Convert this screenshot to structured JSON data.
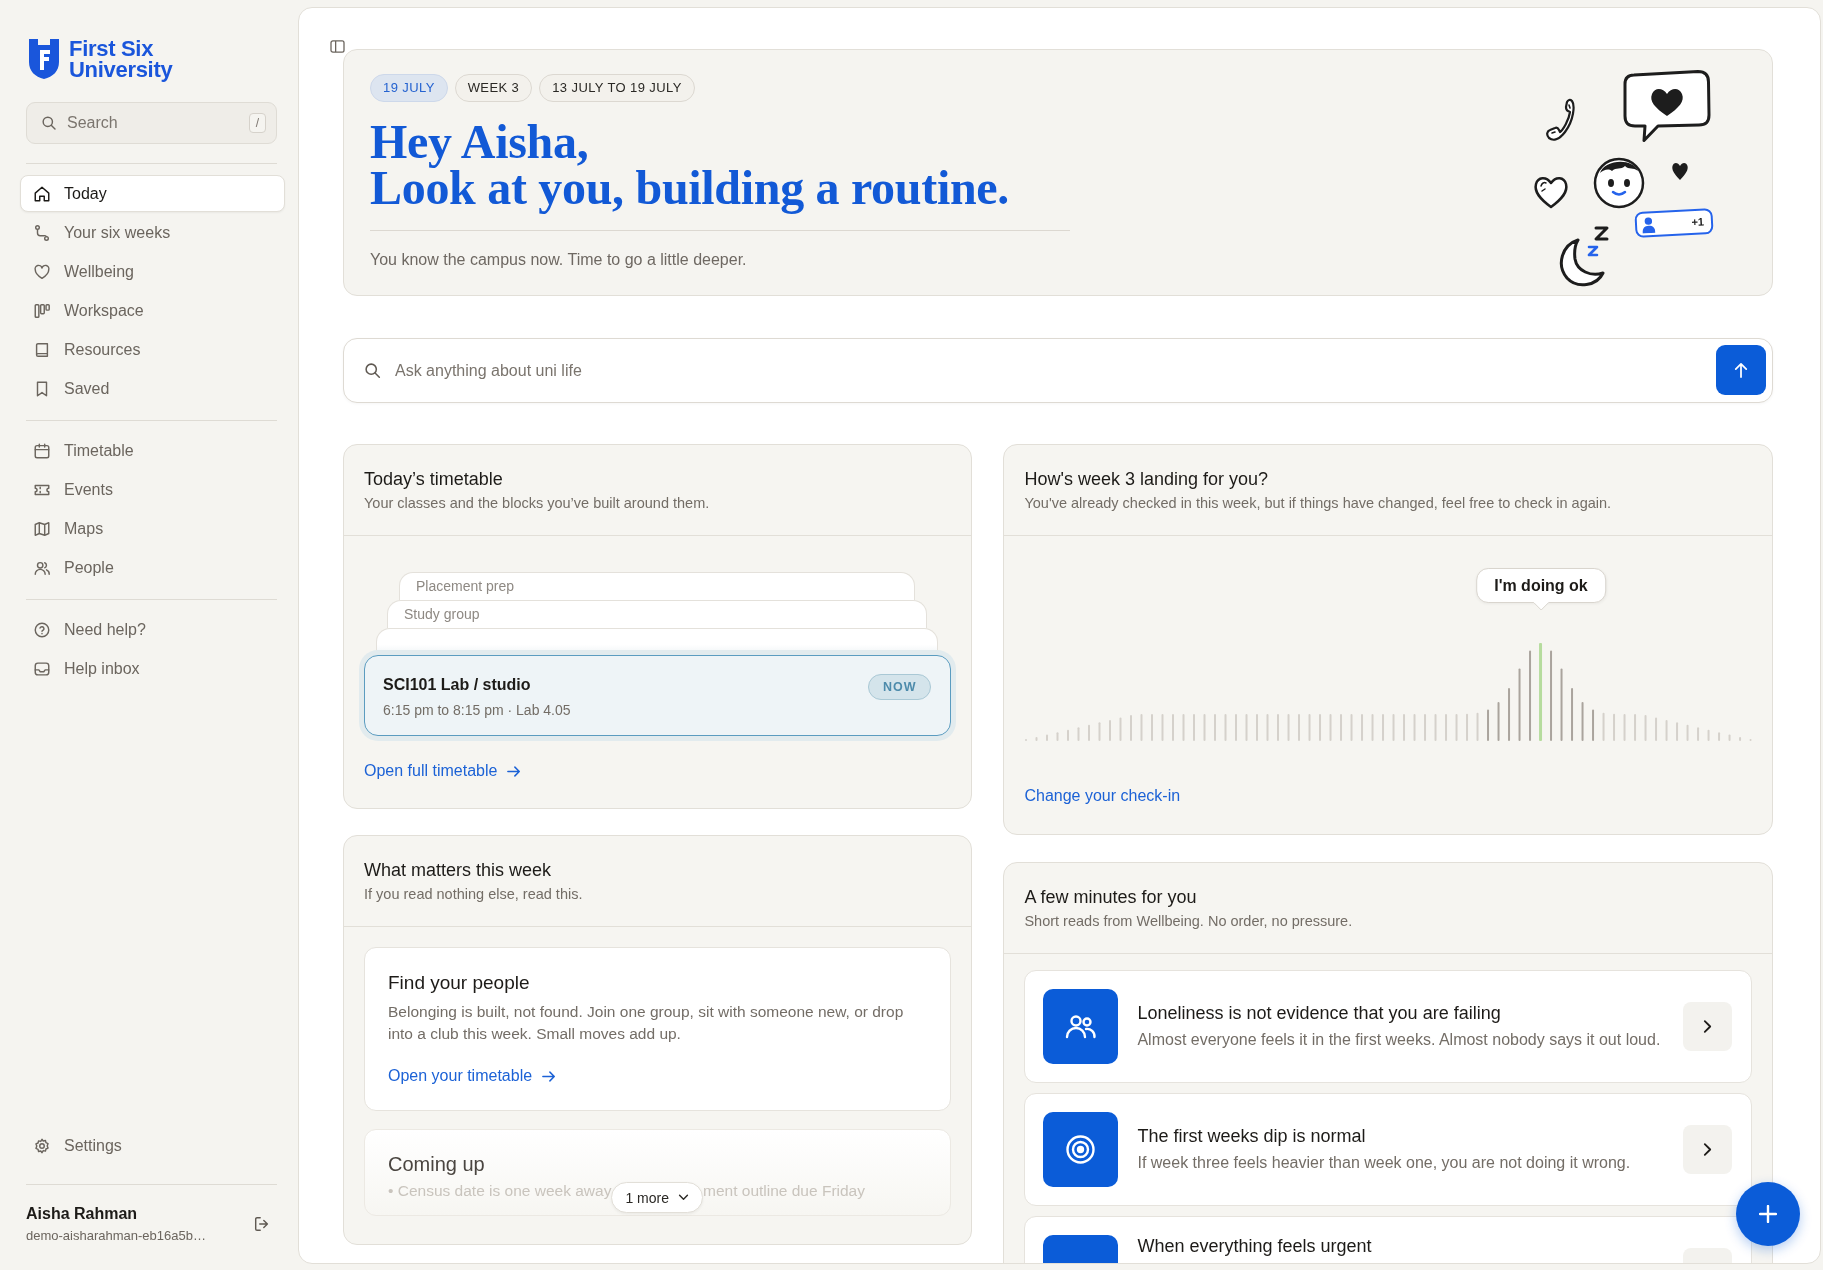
{
  "sidebar": {
    "brand": "First Six University",
    "search": {
      "placeholder": "Search",
      "shortcut": "/"
    },
    "nav_sections": [
      {
        "items": [
          {
            "label": "Today",
            "selected": true
          },
          {
            "label": "Your six weeks",
            "selected": false
          },
          {
            "label": "Wellbeing",
            "selected": false
          },
          {
            "label": "Workspace",
            "selected": false
          },
          {
            "label": "Resources",
            "selected": false
          },
          {
            "label": "Saved",
            "selected": false
          }
        ]
      },
      {
        "items": [
          {
            "label": "Timetable",
            "selected": false
          },
          {
            "label": "Events",
            "selected": false
          },
          {
            "label": "Maps",
            "selected": false
          },
          {
            "label": "People",
            "selected": false
          }
        ]
      },
      {
        "items": [
          {
            "label": "Need help?",
            "selected": false
          },
          {
            "label": "Help inbox",
            "selected": false
          }
        ]
      }
    ],
    "settings": {
      "label": "Settings",
      "selected": false
    },
    "user": {
      "name": "Aisha Rahman",
      "email": "demo-aisharahman-eb16a5b…"
    }
  },
  "hero": {
    "chips": [
      {
        "label": "19 JULY",
        "highlighted": true
      },
      {
        "label": "WEEK 3",
        "highlighted": false
      },
      {
        "label": "13 JULY TO 19 JULY",
        "highlighted": false
      }
    ],
    "greeting": "Hey Aisha,",
    "headline": "Look at you, building a routine.",
    "subtitle": "You know the campus now. Time to go a little deeper.",
    "sticker_text": "+1"
  },
  "ask": {
    "placeholder": "Ask anything about uni life"
  },
  "timetable": {
    "title": "Today’s timetable",
    "subtitle": "Your classes and the blocks you’ve built around them.",
    "upcoming": [
      {
        "kind": "titled",
        "title": "Placement prep"
      },
      {
        "kind": "titled",
        "title": "Study group"
      },
      {
        "kind": "covered"
      }
    ],
    "current": {
      "title": "SCI101 Lab / studio",
      "detail": "6:15 pm to 8:15 pm · Lab 4.05",
      "badge": "NOW"
    },
    "link": "Open full timetable"
  },
  "checkin": {
    "title": "How's week 3 landing for you?",
    "subtitle": "You've already checked in this week, but if things have changed, feel free to check in again.",
    "level": 0.71,
    "mood": "I'm doing ok",
    "link": "Change your check-in"
  },
  "priorities": {
    "title": "What matters this week",
    "subtitle": "If you read nothing else, read this.",
    "feature": {
      "title": "Find your people",
      "body": "Belonging is built, not found. Join one group, sit with someone new, or drop into a club this week. Small moves add up.",
      "link": "Open your timetable"
    },
    "coming_up": {
      "title": "Coming up",
      "items": [
        "• Census date is one week away",
        "ment outline due Friday"
      ],
      "more": "1 more"
    }
  },
  "reads": {
    "title": "A few minutes for you",
    "subtitle": "Short reads from Wellbeing. No order, no pressure.",
    "items": [
      {
        "title": "Loneliness is not evidence that you are failing",
        "summary": "Almost everyone feels it in the first weeks. Almost nobody says it out loud."
      },
      {
        "title": "The first weeks dip is normal",
        "summary": "If week three feels heavier than week one, you are not doing it wrong."
      },
      {
        "title": "When everything feels urgent"
      }
    ]
  }
}
